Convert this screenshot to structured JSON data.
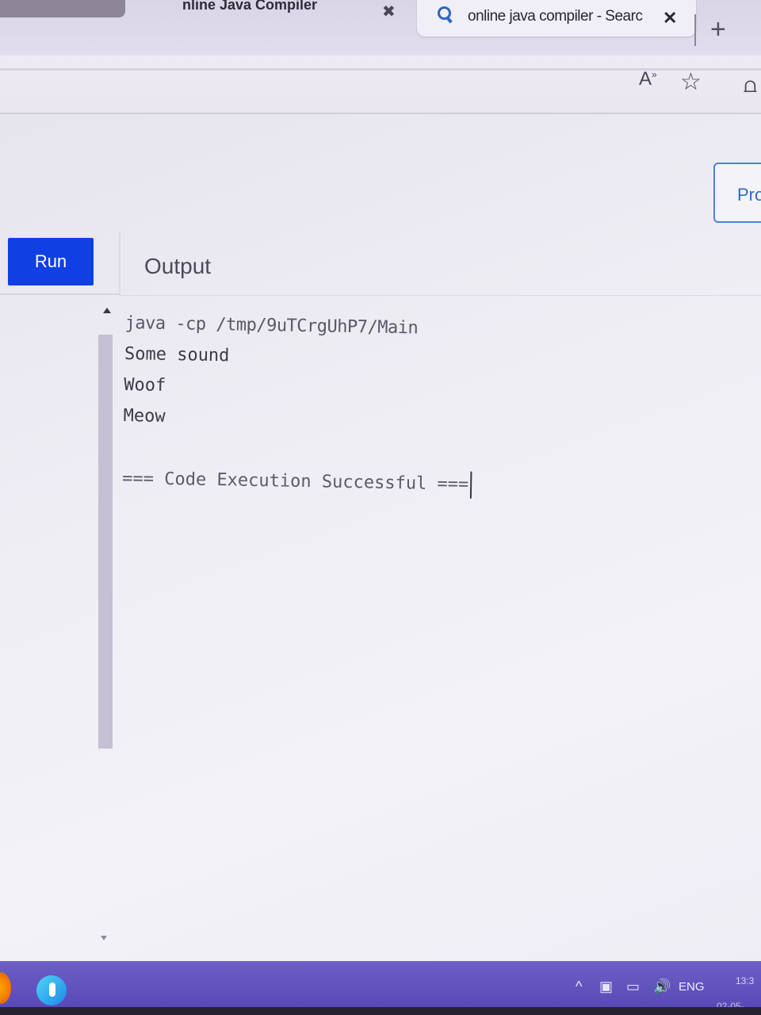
{
  "browser": {
    "tabs": [
      {
        "title": "nline Java Compiler",
        "close_glyph": "✖"
      },
      {
        "title": "online java compiler - Searc",
        "close_glyph": "✕",
        "active": true
      }
    ],
    "new_tab_glyph": "+",
    "toolbar": {
      "read_aloud_glyph": "A",
      "read_aloud_sup": "»",
      "favorite_glyph": "☆",
      "collections_glyph": "⩍"
    }
  },
  "page": {
    "pro_label": "Pro",
    "run_label": "Run",
    "output_heading": "Output",
    "console_lines": {
      "command": "java -cp /tmp/9uTCrgUhP7/Main",
      "line1": "Some sound",
      "line2": "Woof",
      "line3": "Meow",
      "success": "=== Code Execution Successful ==="
    }
  },
  "taskbar": {
    "tray_chevron": "^",
    "tray_icons": "▣ ▭ 🔊",
    "language": "ENG",
    "time": "13:3",
    "date": "02-05-"
  },
  "colors": {
    "run_button": "#1040e4",
    "taskbar": "#5d4fbf",
    "link_blue": "#2f6cc8"
  }
}
